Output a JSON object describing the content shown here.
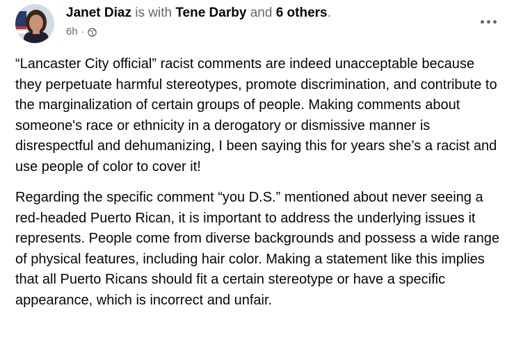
{
  "post": {
    "author": "Janet Diaz",
    "with_text": "is with",
    "tagged": "Tene Darby",
    "and_text": "and",
    "others": "6 others",
    "period": ".",
    "time": "6h",
    "separator": "·",
    "privacy_icon": "globe-icon",
    "more_icon": "more-options-icon",
    "paragraphs": [
      "“Lancaster City official” racist comments are indeed unacceptable because they perpetuate harmful stereotypes, promote discrimination, and contribute to the marginalization of certain groups of people. Making comments about someone's race or ethnicity in a derogatory or dismissive manner is disrespectful and dehumanizing, I been saying this for years she’s a racist and use people of color to cover it!",
      "Regarding the specific comment “you D.S.” mentioned about never seeing a red-headed Puerto Rican, it is important to address the underlying issues it represents. People come from diverse backgrounds and possess a wide range of physical features, including hair color. Making a statement like this implies that all Puerto Ricans should fit a certain stereotype or have a specific appearance, which is incorrect and unfair."
    ]
  },
  "colors": {
    "text_primary": "#050505",
    "text_secondary": "#65676b",
    "background": "#ffffff"
  }
}
